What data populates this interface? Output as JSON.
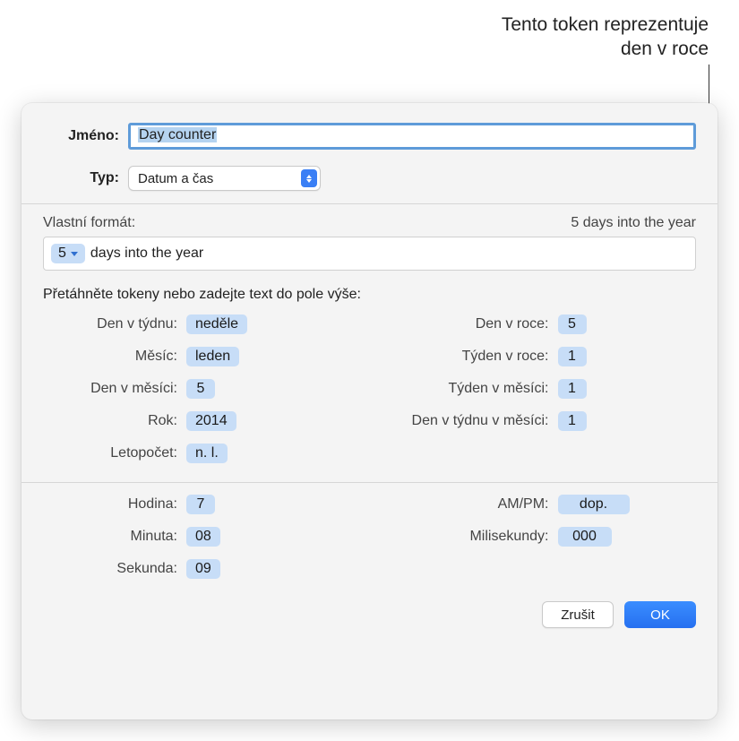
{
  "callout": {
    "line1": "Tento token reprezentuje",
    "line2": "den v roce"
  },
  "form": {
    "name_label": "Jméno:",
    "name_value": "Day counter",
    "type_label": "Typ:",
    "type_value": "Datum a čas"
  },
  "format": {
    "header": "Vlastní formát:",
    "preview": "5 days into the year",
    "token_value": "5",
    "suffix_text": "days into the year"
  },
  "drag_instruction": "Přetáhněte tokeny nebo zadejte text do pole výše:",
  "tokens": {
    "left": [
      {
        "label": "Den v týdnu:",
        "value": "neděle"
      },
      {
        "label": "Měsíc:",
        "value": "leden"
      },
      {
        "label": "Den v měsíci:",
        "value": "5"
      },
      {
        "label": "Rok:",
        "value": "2014"
      },
      {
        "label": "Letopočet:",
        "value": "n. l."
      }
    ],
    "right": [
      {
        "label": "Den v roce:",
        "value": "5"
      },
      {
        "label": "Týden v roce:",
        "value": "1"
      },
      {
        "label": "Týden v měsíci:",
        "value": "1"
      },
      {
        "label": "Den v týdnu v měsíci:",
        "value": "1"
      }
    ]
  },
  "time_tokens": {
    "left": [
      {
        "label": "Hodina:",
        "value": "7"
      },
      {
        "label": "Minuta:",
        "value": "08"
      },
      {
        "label": "Sekunda:",
        "value": "09"
      }
    ],
    "right": [
      {
        "label": "AM/PM:",
        "value": "dop."
      },
      {
        "label": "Milisekundy:",
        "value": "000"
      }
    ]
  },
  "buttons": {
    "cancel": "Zrušit",
    "ok": "OK"
  }
}
